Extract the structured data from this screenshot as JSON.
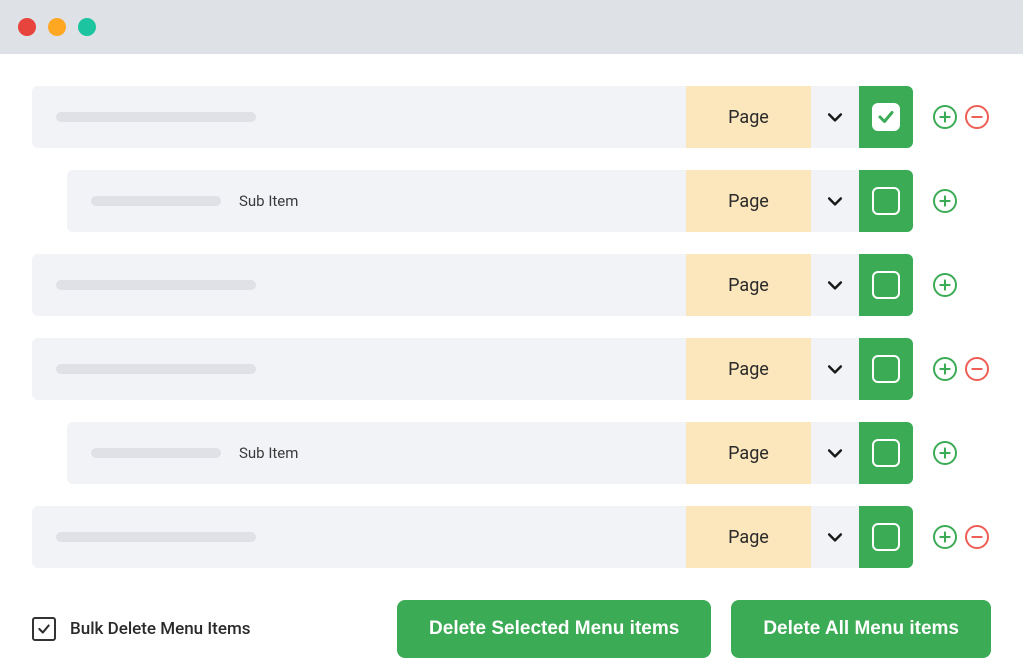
{
  "colors": {
    "accent": "#3CAB55",
    "danger": "#ED5E55",
    "badge": "#FCE7BD",
    "row": "#F2F3F7"
  },
  "rows": [
    {
      "sub": false,
      "sub_label": "",
      "type": "Page",
      "checked": true,
      "show_add": true,
      "show_del": true
    },
    {
      "sub": true,
      "sub_label": "Sub Item",
      "type": "Page",
      "checked": false,
      "show_add": true,
      "show_del": false
    },
    {
      "sub": false,
      "sub_label": "",
      "type": "Page",
      "checked": false,
      "show_add": true,
      "show_del": false
    },
    {
      "sub": false,
      "sub_label": "",
      "type": "Page",
      "checked": false,
      "show_add": true,
      "show_del": true
    },
    {
      "sub": true,
      "sub_label": "Sub Item",
      "type": "Page",
      "checked": false,
      "show_add": true,
      "show_del": false
    },
    {
      "sub": false,
      "sub_label": "",
      "type": "Page",
      "checked": false,
      "show_add": true,
      "show_del": true
    }
  ],
  "footer": {
    "bulk_checked": true,
    "bulk_label": "Bulk Delete Menu Items",
    "delete_selected": "Delete Selected Menu items",
    "delete_all": "Delete All Menu items"
  }
}
